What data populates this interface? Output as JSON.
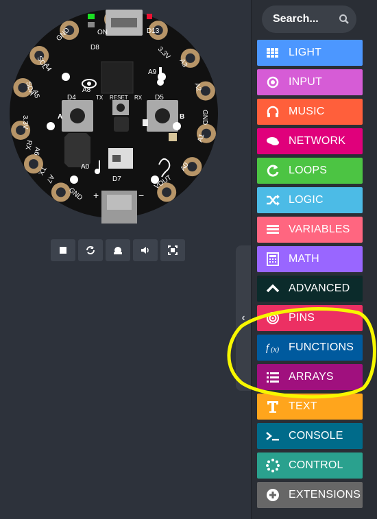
{
  "board": {
    "labels": {
      "d13": "D13",
      "d8": "D8",
      "d4": "D4",
      "d5": "D5",
      "d7": "D7",
      "a0": "A0",
      "a0_pad": "A0",
      "a1": "A1",
      "a2": "A2",
      "a3": "A3",
      "a4": "A4",
      "a5": "A5",
      "a6": "A6",
      "a7": "A7",
      "a8": "A8",
      "a9": "A9",
      "scl": "SCL",
      "sda": "SDA",
      "rx_left": "RX",
      "tx_left": "TX",
      "gnd_tl": "GND",
      "gnd_tr": "GND",
      "gnd_r": "GND",
      "gnd_bl": "GND",
      "v33_l": "3.3V",
      "v33_r": "3.3V",
      "vout": "VOUT",
      "reset": "RESET",
      "tx": "TX",
      "rx": "RX",
      "btn_a": "A",
      "btn_b": "B",
      "on": "ON",
      "plus": "+",
      "minus": "−"
    }
  },
  "sim_toolbar": [
    "stop",
    "restart",
    "slow-motion",
    "mute",
    "fullscreen"
  ],
  "toolbox": {
    "search_placeholder": "Search...",
    "categories": [
      {
        "label": "LIGHT",
        "color": "#4c97ff",
        "icon": "grid"
      },
      {
        "label": "INPUT",
        "color": "#d65cd6",
        "icon": "target"
      },
      {
        "label": "MUSIC",
        "color": "#ff5f3b",
        "icon": "headphones"
      },
      {
        "label": "NETWORK",
        "color": "#e0007b",
        "icon": "chat"
      },
      {
        "label": "LOOPS",
        "color": "#4cc443",
        "icon": "refresh"
      },
      {
        "label": "LOGIC",
        "color": "#4cbbe6",
        "icon": "shuffle"
      },
      {
        "label": "VARIABLES",
        "color": "#ff6680",
        "icon": "lines"
      },
      {
        "label": "MATH",
        "color": "#9966ff",
        "icon": "calculator"
      },
      {
        "label": "ADVANCED",
        "color": "#0b2b2b",
        "icon": "chevron-up"
      },
      {
        "label": "PINS",
        "color": "#ec3063",
        "icon": "rings"
      },
      {
        "label": "FUNCTIONS",
        "color": "#005a9e",
        "icon": "fx"
      },
      {
        "label": "ARRAYS",
        "color": "#a0107e",
        "icon": "list"
      },
      {
        "label": "TEXT",
        "color": "#ffa51c",
        "icon": "text"
      },
      {
        "label": "CONSOLE",
        "color": "#006b8a",
        "icon": "terminal"
      },
      {
        "label": "CONTROL",
        "color": "#2aa18e",
        "icon": "spinner"
      },
      {
        "label": "EXTENSIONS",
        "color": "#676767",
        "icon": "plus-circle"
      }
    ]
  },
  "annotation": {
    "color": "#f7f700"
  }
}
